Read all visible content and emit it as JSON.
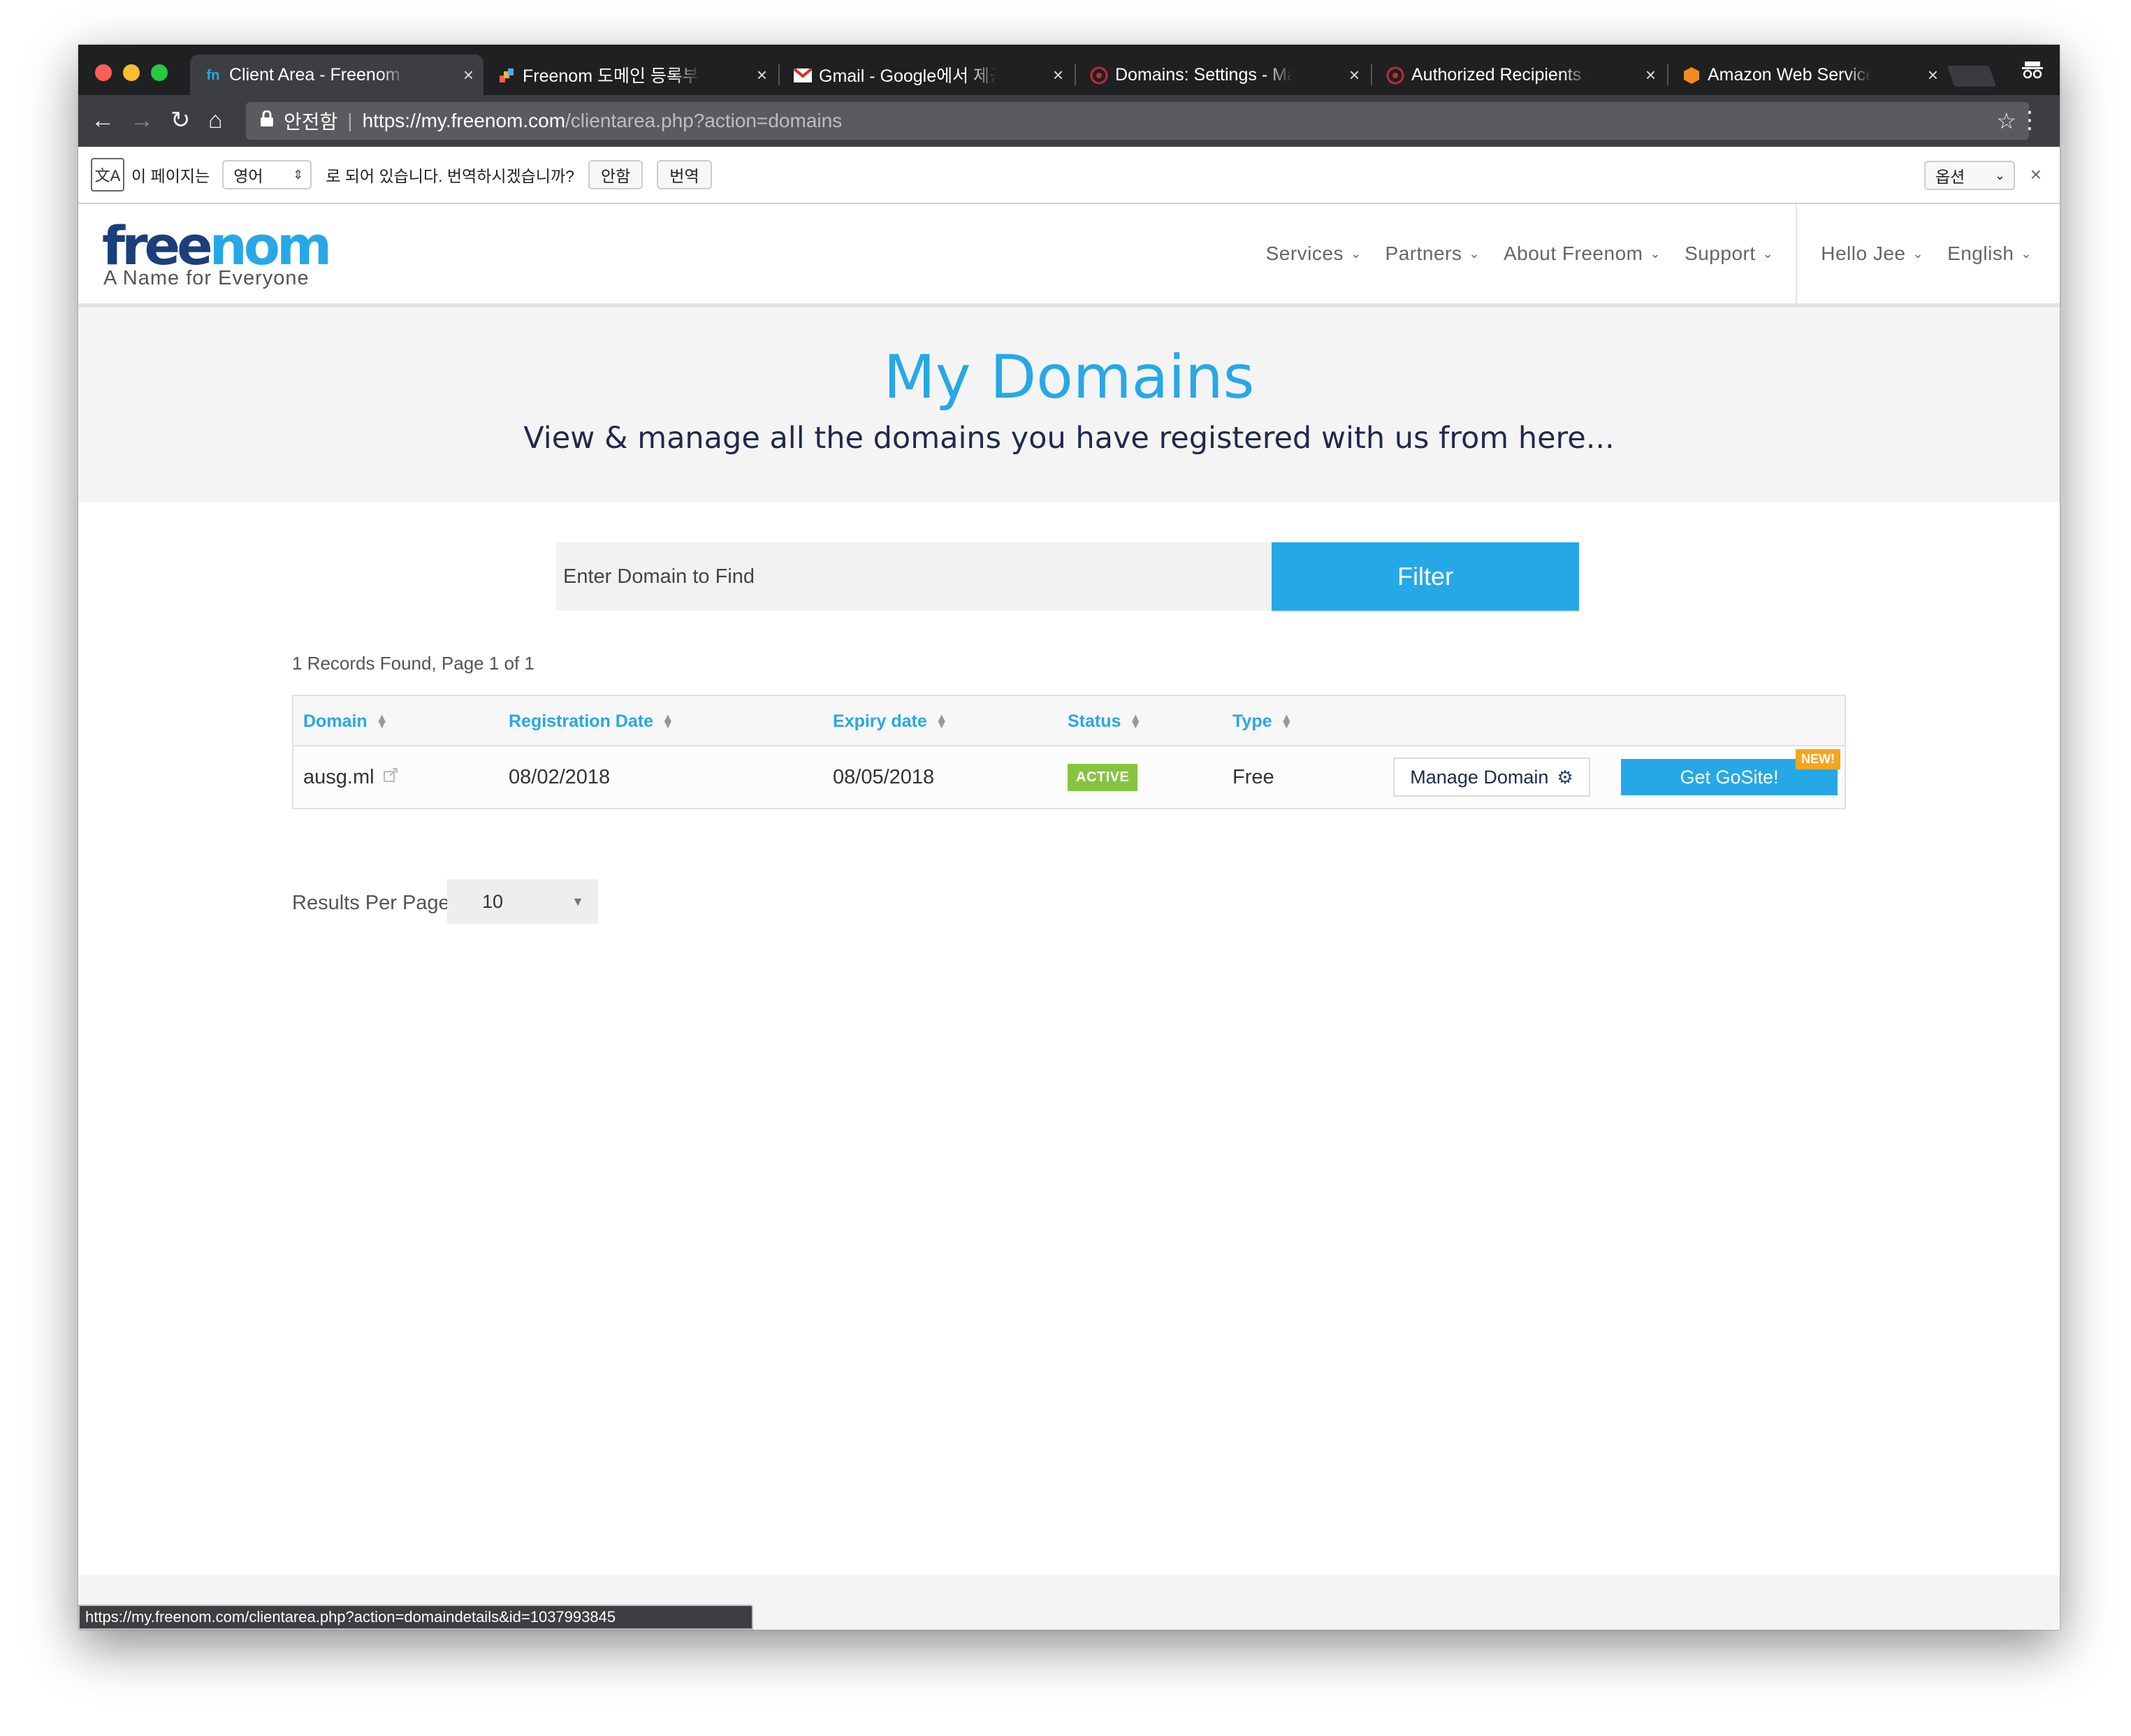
{
  "browser": {
    "tabs": [
      {
        "title": "Client Area - Freenom",
        "icon": "freenom-favicon",
        "active": true
      },
      {
        "title": "Freenom 도메인 등록부터 네임",
        "icon": "colorful-favicon",
        "active": false
      },
      {
        "title": "Gmail - Google에서 제공하는",
        "icon": "gmail-icon",
        "active": false
      },
      {
        "title": "Domains: Settings - Mailgun",
        "icon": "mailgun-icon",
        "active": false
      },
      {
        "title": "Authorized Recipients – Mail",
        "icon": "mailgun-icon",
        "active": false
      },
      {
        "title": "Amazon Web Services Sign",
        "icon": "aws-icon",
        "active": false
      }
    ],
    "tab_close": "×",
    "address": {
      "secure_label": "안전함",
      "url_host": "https://my.freenom.com",
      "url_path": "/clientarea.php?action=domains"
    },
    "status_url": "https://my.freenom.com/clientarea.php?action=domaindetails&id=1037993845"
  },
  "translate_bar": {
    "prefix": "이 페이지는",
    "language": "영어",
    "suffix": "로 되어 있습니다. 번역하시겠습니까?",
    "decline_label": "안함",
    "translate_label": "번역",
    "options_label": "옵션",
    "close": "×"
  },
  "site": {
    "logo_free": "free",
    "logo_nom": "nom",
    "tagline": "A Name for Everyone",
    "nav": [
      "Services",
      "Partners",
      "About Freenom",
      "Support"
    ],
    "user_nav": [
      "Hello Jee",
      "English"
    ]
  },
  "hero": {
    "title": "My Domains",
    "subtitle": "View & manage all the domains you have registered with us from here..."
  },
  "search": {
    "placeholder": "Enter Domain to Find",
    "filter_label": "Filter"
  },
  "records_text": "1 Records Found, Page 1 of 1",
  "table": {
    "columns": [
      "Domain",
      "Registration Date",
      "Expiry date",
      "Status",
      "Type"
    ],
    "rows": [
      {
        "domain": "ausg.ml",
        "registration_date": "08/02/2018",
        "expiry_date": "08/05/2018",
        "status": "ACTIVE",
        "type": "Free",
        "manage_label": "Manage Domain",
        "gosite_label": "Get GoSite!",
        "new_badge": "NEW!"
      }
    ]
  },
  "pagination": {
    "results_label": "Results Per Page:",
    "per_page": "10"
  },
  "colors": {
    "brand_blue": "#27a8e6",
    "brand_navy": "#1a3f7a",
    "active_green": "#86c440",
    "new_orange": "#f7a51b"
  }
}
